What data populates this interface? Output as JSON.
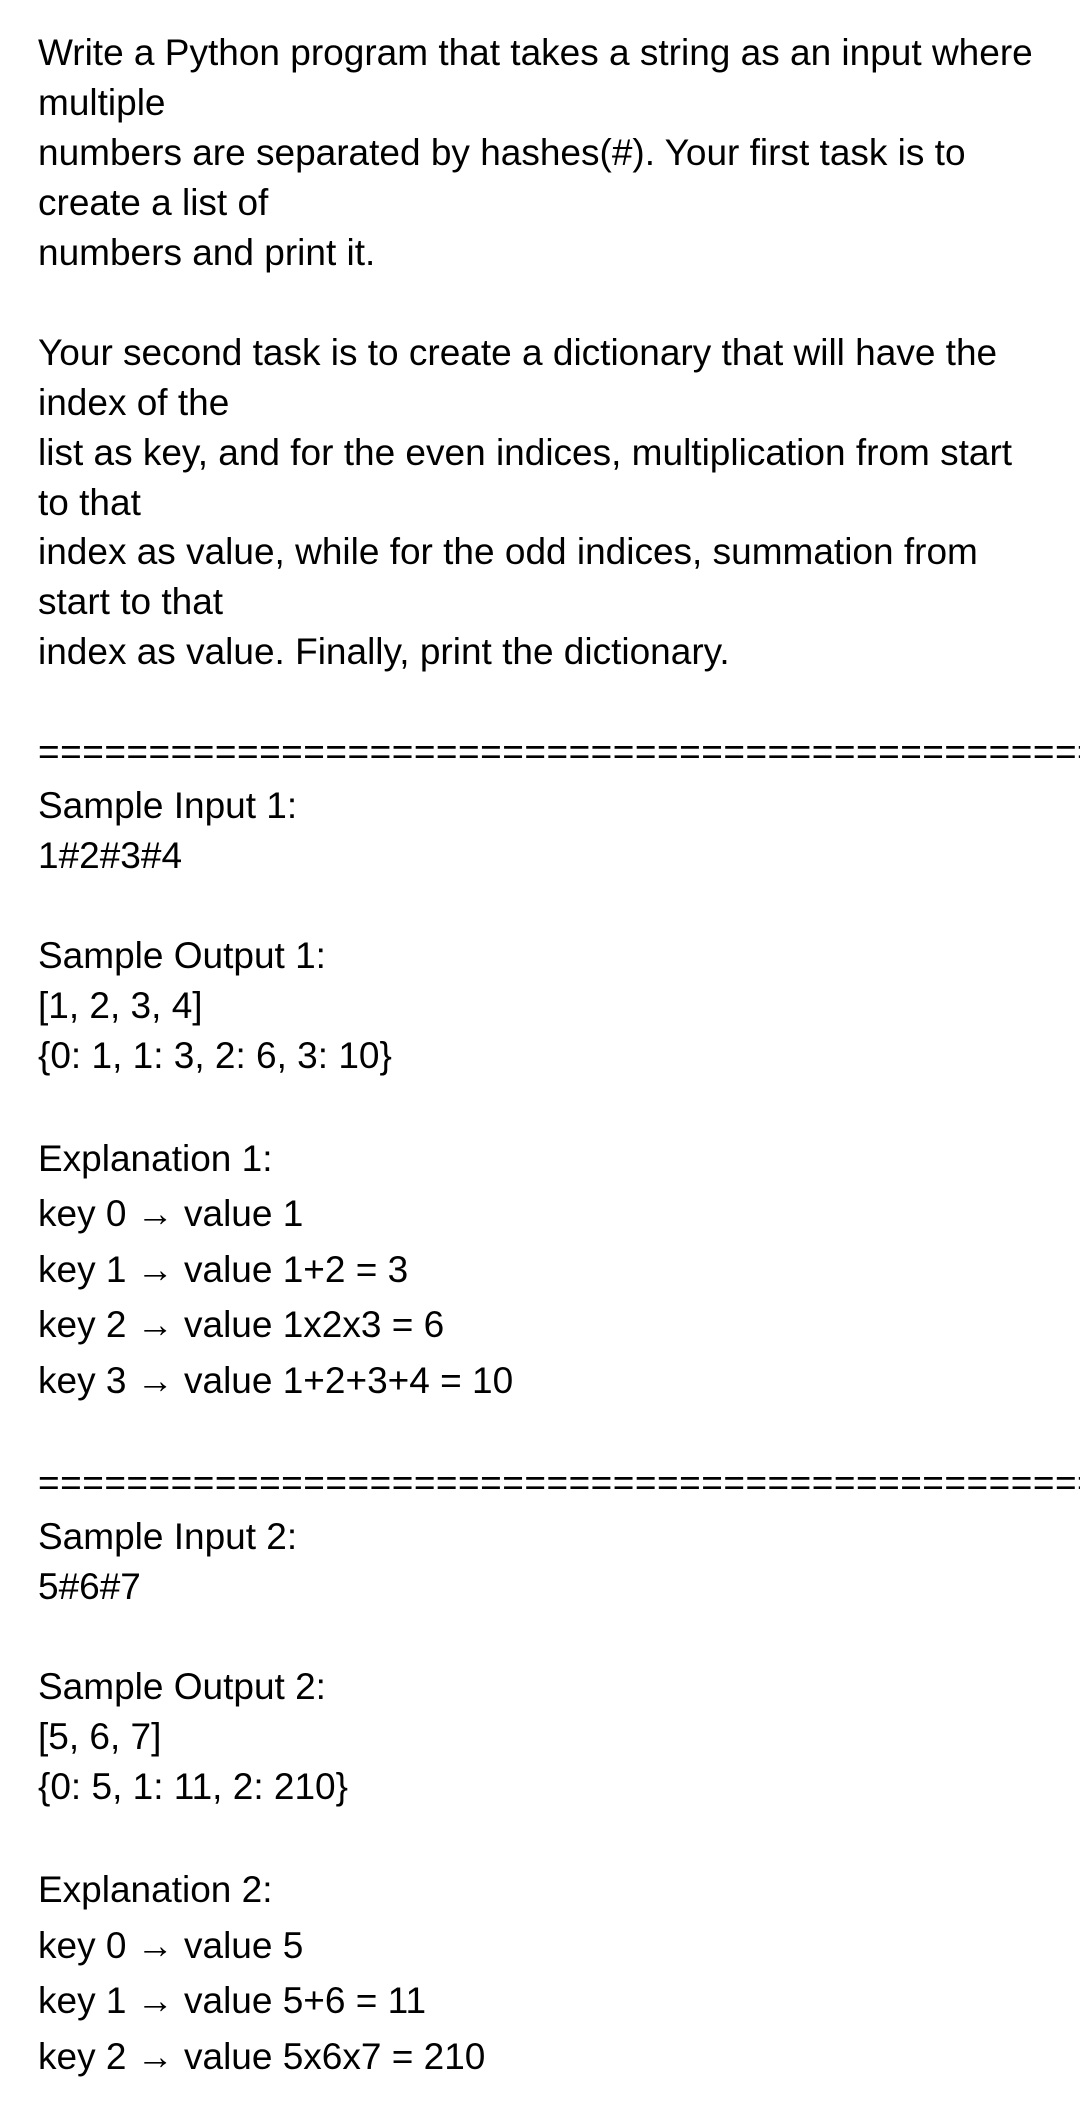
{
  "problem": {
    "para1_l1": "Write a Python program that takes a string as an input where multiple",
    "para1_l2": "numbers are separated by hashes(#). Your first task is to create a list of",
    "para1_l3": "numbers and print it.",
    "para2_l1": "Your second task is to create a dictionary that will have the index of the",
    "para2_l2": "list as key, and for the even indices, multiplication from start to that",
    "para2_l3": "index as value, while for the odd indices, summation from start to that",
    "para2_l4": "index as value. Finally, print the dictionary."
  },
  "divider": "===================================================",
  "sample1": {
    "input_label": "Sample Input 1:",
    "input_value": "1#2#3#4",
    "output_label": "Sample Output 1:",
    "output_line1": "[1, 2, 3, 4]",
    "output_line2": "{0: 1, 1: 3, 2: 6, 3: 10}",
    "explain_label": "Explanation 1:",
    "exp_l1": "key 0  →  value 1",
    "exp_l2": "key 1  →  value 1+2 = 3",
    "exp_l3": "key 2  →  value 1x2x3 = 6",
    "exp_l4": "key 3  →  value 1+2+3+4 = 10"
  },
  "sample2": {
    "input_label": "Sample Input 2:",
    "input_value": "5#6#7",
    "output_label": "Sample Output 2:",
    "output_line1": "[5, 6, 7]",
    "output_line2": "{0: 5, 1: 11, 2: 210}",
    "explain_label": "Explanation 2:",
    "exp_l1": "key 0  →  value 5",
    "exp_l2": "key 1  →  value 5+6 = 11",
    "exp_l3": "key 2  →  value 5x6x7 = 210"
  }
}
